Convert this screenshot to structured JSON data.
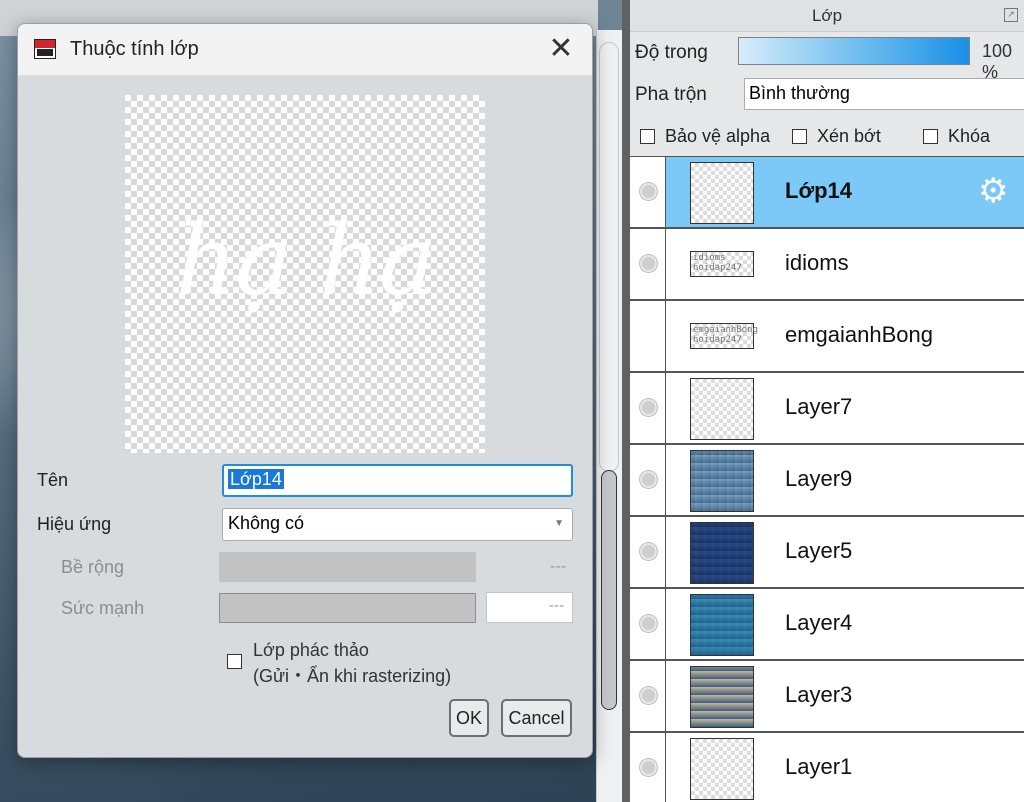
{
  "dialog": {
    "title": "Thuộc tính lớp",
    "close_glyph": "✕",
    "preview_text": "hạ hạ",
    "name_label": "Tên",
    "name_value": "Lớp14",
    "effect_label": "Hiệu ứng",
    "effect_value": "Không có",
    "width_label": "Bề rộng",
    "width_value": "---",
    "strength_label": "Sức mạnh",
    "strength_value": "---",
    "draft_line1": "Lớp phác thảo",
    "draft_line2": "(Gửi・Ẩn khi rasterizing)",
    "ok_label": "OK",
    "cancel_label": "Cancel"
  },
  "panel": {
    "title": "Lớp",
    "opacity_label": "Độ trong",
    "opacity_value": "100 %",
    "blend_label": "Pha trộn",
    "blend_value": "Bình thường",
    "protect_alpha": "Bảo vệ alpha",
    "clipping": "Xén bớt",
    "lock": "Khóa",
    "layers": [
      {
        "name": "Lớp14",
        "selected": true,
        "visible": true,
        "thumb": "transparent",
        "thumb_text": ""
      },
      {
        "name": "idioms",
        "selected": false,
        "visible": true,
        "thumb": "text",
        "thumb_text": "idioms\nhoidap247"
      },
      {
        "name": "emgaianhBong",
        "selected": false,
        "visible": false,
        "thumb": "text",
        "thumb_text": "emgaianhBong\nhoidap247"
      },
      {
        "name": "Layer7",
        "selected": false,
        "visible": true,
        "thumb": "transparent",
        "thumb_text": ""
      },
      {
        "name": "Layer9",
        "selected": false,
        "visible": true,
        "thumb": "sky1",
        "thumb_text": ""
      },
      {
        "name": "Layer5",
        "selected": false,
        "visible": true,
        "thumb": "sky2",
        "thumb_text": ""
      },
      {
        "name": "Layer4",
        "selected": false,
        "visible": true,
        "thumb": "sky3",
        "thumb_text": ""
      },
      {
        "name": "Layer3",
        "selected": false,
        "visible": true,
        "thumb": "sky4",
        "thumb_text": ""
      },
      {
        "name": "Layer1",
        "selected": false,
        "visible": true,
        "thumb": "transparent",
        "thumb_text": ""
      }
    ]
  },
  "colors": {
    "selected_row": "#7cc8f6",
    "input_focus": "#1e90d8",
    "selection_highlight": "#1979d9"
  }
}
